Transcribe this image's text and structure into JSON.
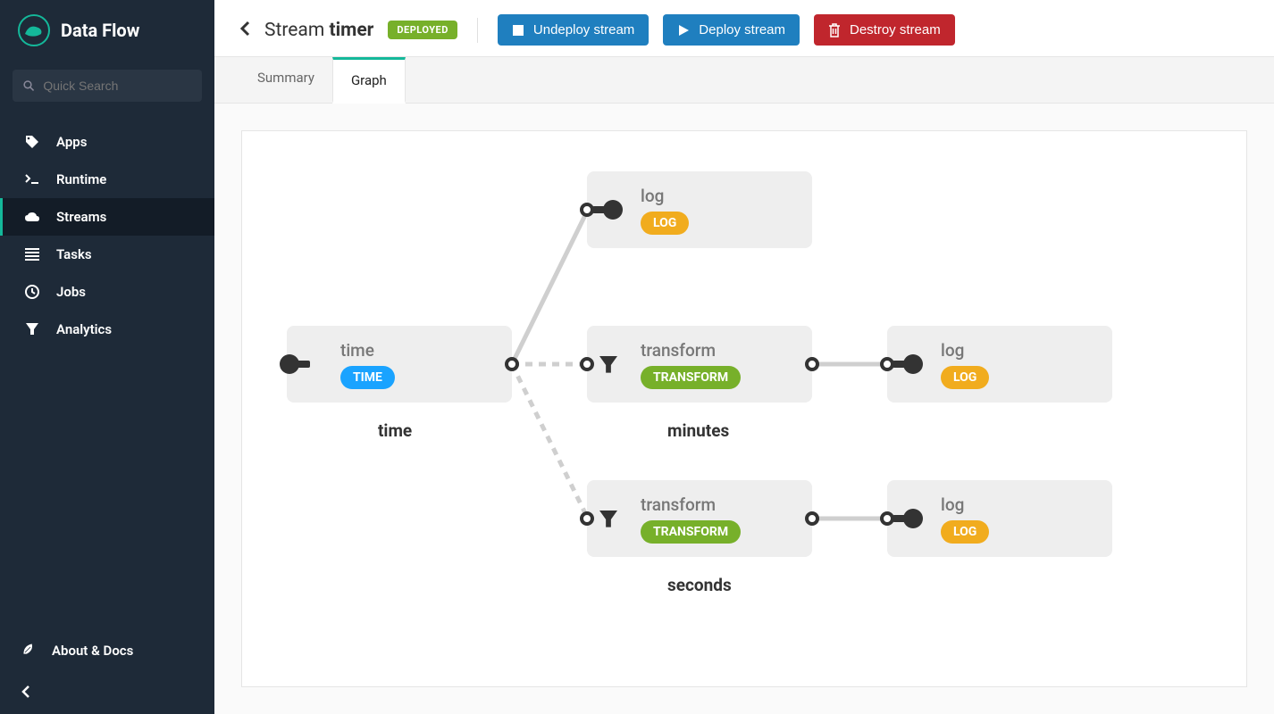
{
  "app": {
    "name": "Data Flow"
  },
  "search": {
    "placeholder": "Quick Search"
  },
  "nav": {
    "items": [
      {
        "label": "Apps"
      },
      {
        "label": "Runtime"
      },
      {
        "label": "Streams"
      },
      {
        "label": "Tasks"
      },
      {
        "label": "Jobs"
      },
      {
        "label": "Analytics"
      }
    ],
    "about": "About & Docs"
  },
  "header": {
    "prefix": "Stream",
    "name": "timer",
    "status": "DEPLOYED",
    "btn_undeploy": "Undeploy stream",
    "btn_deploy": "Deploy stream",
    "btn_destroy": "Destroy stream"
  },
  "tabs": {
    "summary": "Summary",
    "graph": "Graph"
  },
  "graph": {
    "nodes": {
      "time": {
        "label": "time",
        "tag": "TIME"
      },
      "log1": {
        "label": "log",
        "tag": "LOG"
      },
      "transform1": {
        "label": "transform",
        "tag": "TRANSFORM"
      },
      "log2": {
        "label": "log",
        "tag": "LOG"
      },
      "transform2": {
        "label": "transform",
        "tag": "TRANSFORM"
      },
      "log3": {
        "label": "log",
        "tag": "LOG"
      }
    },
    "streams": {
      "time": "time",
      "minutes": "minutes",
      "seconds": "seconds"
    }
  }
}
